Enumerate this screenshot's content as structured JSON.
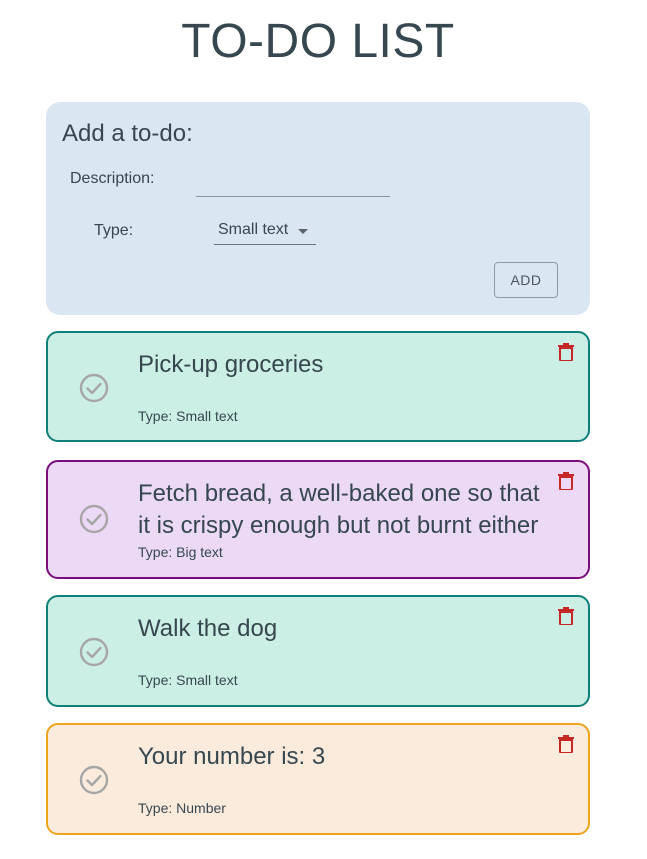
{
  "page": {
    "title": "TO-DO LIST"
  },
  "add_form": {
    "heading": "Add a to-do:",
    "description_label": "Description:",
    "description_value": "",
    "type_label": "Type:",
    "type_selected": "Small text",
    "add_button_label": "ADD"
  },
  "todos": [
    {
      "text": "Pick-up groceries",
      "type_label": "Type: Small text",
      "kind": "small",
      "border_color": "#0f7f7a",
      "background_color": "#cbeee5"
    },
    {
      "text": "Fetch bread, a well-baked one so that it is crispy enough but not burnt either",
      "type_label": "Type: Big text",
      "kind": "big",
      "border_color": "#7d0b7e",
      "background_color": "#ebd9f6"
    },
    {
      "text": "Walk the dog",
      "type_label": "Type: Small text",
      "kind": "small",
      "border_color": "#0f7f7a",
      "background_color": "#cbeee5"
    },
    {
      "text": "Your number is: 3",
      "type_label": "Type: Number",
      "kind": "number",
      "border_color": "#f0a41e",
      "background_color": "#faebdc"
    }
  ],
  "icons": {
    "complete": "check-circle-icon",
    "delete": "trash-icon",
    "dropdown": "caret-down-icon"
  },
  "colors": {
    "text": "#37474f",
    "form_panel": "#dae7f3",
    "delete_icon": "#c62828",
    "check_icon": "#a6a6a6"
  }
}
